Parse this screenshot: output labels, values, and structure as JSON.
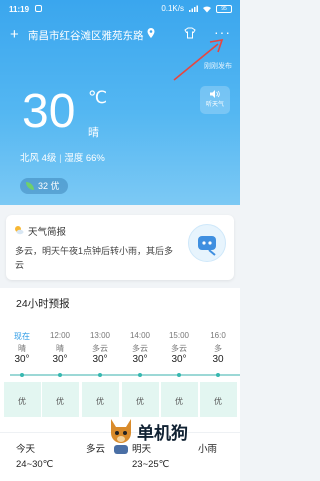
{
  "status_bar": {
    "time": "11:19",
    "network_speed": "0.1K/s",
    "battery": "95"
  },
  "topbar": {
    "location": "南昌市红谷滩区雅苑东路"
  },
  "publish_time": "刚刚发布",
  "current": {
    "temperature": "30",
    "unit": "℃",
    "condition": "晴",
    "wind": "北风 4级",
    "humidity": "湿度 66%",
    "aqi": "32 优",
    "listen_label": "听天气"
  },
  "brief": {
    "title": "天气简报",
    "text": "多云，明天午夜1点钟后转小雨，其后多云"
  },
  "hourly": {
    "title": "24小时预报",
    "items": [
      {
        "time": "现在",
        "cond": "晴",
        "temp": "30°",
        "aqi": "优"
      },
      {
        "time": "12:00",
        "cond": "晴",
        "temp": "30°",
        "aqi": "优"
      },
      {
        "time": "13:00",
        "cond": "多云",
        "temp": "30°",
        "aqi": "优"
      },
      {
        "time": "14:00",
        "cond": "多云",
        "temp": "30°",
        "aqi": "优"
      },
      {
        "time": "15:00",
        "cond": "多云",
        "temp": "30°",
        "aqi": "优"
      },
      {
        "time": "16:0",
        "cond": "多",
        "temp": "30",
        "aqi": "优"
      }
    ]
  },
  "daily": {
    "today_label": "今天",
    "today_cond": "多云",
    "today_range": "24~30℃",
    "tomorrow_label": "明天",
    "tomorrow_cond": "小雨",
    "tomorrow_range": "23~25℃"
  },
  "watermark": "单机狗",
  "colors": {
    "hero_top": "#3aa6ee",
    "accent": "#2d9be6",
    "aqi_line": "#37b8b0"
  }
}
